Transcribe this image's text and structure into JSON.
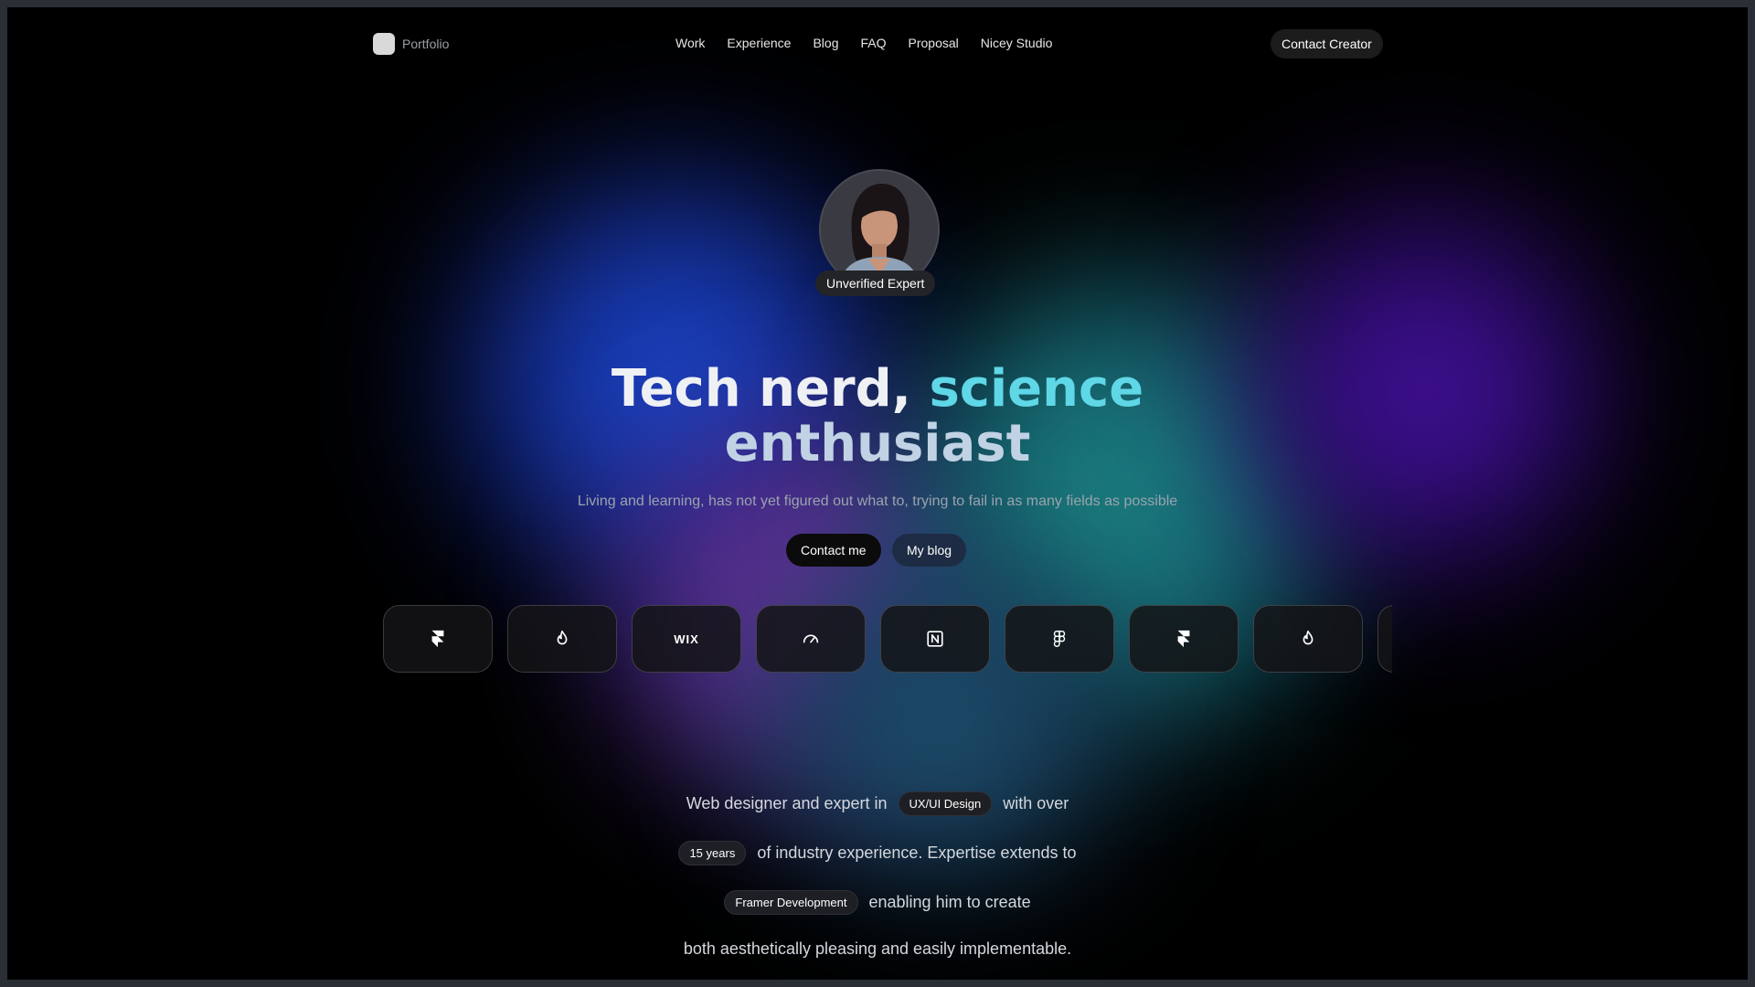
{
  "nav": {
    "logo_text": "Portfolio",
    "links": [
      "Work",
      "Experience",
      "Blog",
      "FAQ",
      "Proposal",
      "Nicey Studio"
    ],
    "cta": "Contact Creator"
  },
  "profile": {
    "badge": "Unverified Expert"
  },
  "hero": {
    "headline_part1": "Tech nerd, ",
    "headline_accent": "science",
    "headline_part2": "enthusiast",
    "subtitle": "Living and learning, has not yet figured out what to, trying to fail in as many fields as possible",
    "primary_button": "Contact me",
    "secondary_button": "My blog"
  },
  "tools": [
    {
      "icon": "framer-icon"
    },
    {
      "icon": "flame-icon"
    },
    {
      "icon": "wix-icon",
      "label": "WIX"
    },
    {
      "icon": "speedometer-icon"
    },
    {
      "icon": "notion-icon"
    },
    {
      "icon": "figma-icon"
    },
    {
      "icon": "framer-icon"
    },
    {
      "icon": "flame-icon"
    }
  ],
  "about": {
    "line1_before": "Web designer and expert in",
    "chip1": "UX/UI Design",
    "line1_after": "with over",
    "chip2": "15 years",
    "line2_after": "of industry experience. Expertise extends to",
    "chip3": "Framer Development",
    "line3_after": "enabling him to create",
    "line4": "both aesthetically pleasing and easily implementable."
  },
  "colors": {
    "accent": "#5fd7e6",
    "background": "#000000",
    "secondary_button": "#1d2c44"
  }
}
